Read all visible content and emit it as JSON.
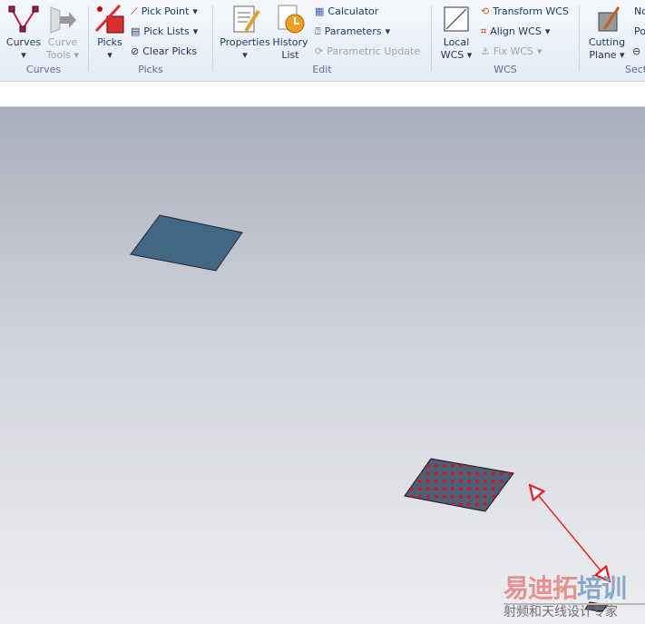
{
  "ribbon": {
    "curves": {
      "group": "Curves",
      "curves": "Curves",
      "curve_tools_1": "Curve",
      "curve_tools_2": "Tools"
    },
    "picks": {
      "group": "Picks",
      "picks": "Picks",
      "pick_point": "Pick Point",
      "pick_lists": "Pick Lists",
      "clear_picks": "Clear Picks"
    },
    "edit": {
      "group": "Edit",
      "properties": "Properties",
      "history_1": "History",
      "history_2": "List",
      "calculator": "Calculator",
      "parameters": "Parameters",
      "parametric_update": "Parametric Update"
    },
    "wcs": {
      "group": "WCS",
      "local_1": "Local",
      "local_2": "WCS",
      "transform": "Transform WCS",
      "align": "Align WCS",
      "fix": "Fix WCS"
    },
    "sections": {
      "group": "Sect",
      "cutting_1": "Cutting",
      "cutting_2": "Plane",
      "no": "No",
      "po": "Po"
    }
  },
  "watermark": {
    "line1a": "易迪拓",
    "line1b": "培训",
    "line2": "射频和天线设计专家"
  },
  "colors": {
    "plate": "#416783",
    "pick": "#e0101a",
    "arrow": "#e82020"
  }
}
